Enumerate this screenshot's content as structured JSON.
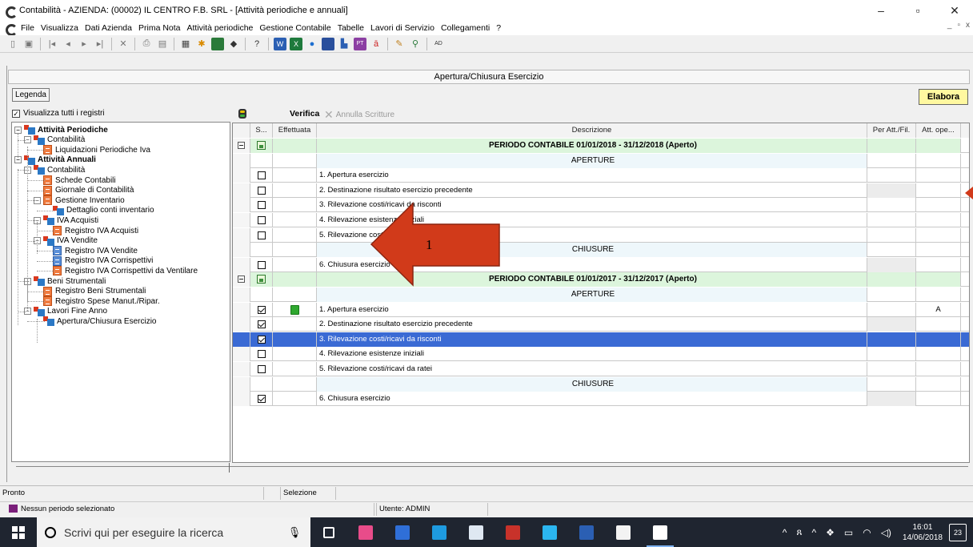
{
  "window": {
    "title": "Contabilità - AZIENDA: (00002) IL CENTRO F.B. SRL  - [Attività periodiche e annuali]",
    "minimize": "–",
    "maximize": "▫",
    "close": "✕"
  },
  "menu": {
    "items": [
      "File",
      "Visualizza",
      "Dati Azienda",
      "Prima Nota",
      "Attività periodiche",
      "Gestione Contabile",
      "Tabelle",
      "Lavori di Servizio",
      "Collegamenti",
      "?"
    ],
    "mdi": [
      "_",
      "▫",
      "x"
    ]
  },
  "toolbar": {
    "label_ad": "AD"
  },
  "form": {
    "title": "Apertura/Chiusura Esercizio",
    "legenda": "Legenda",
    "show_all_registers": "Visualizza tutti i registri",
    "show_all_checked": "✓",
    "verifica": "Verifica",
    "annulla": "Annulla Scritture",
    "elabora": "Elabora"
  },
  "tree": {
    "nodes": [
      {
        "label": "Attività Periodiche",
        "bold": true,
        "level": 0,
        "icon": "folder",
        "expander": "−"
      },
      {
        "label": "Contabilità",
        "level": 1,
        "icon": "folder",
        "expander": "−"
      },
      {
        "label": "Liquidazioni Periodiche Iva",
        "level": 2,
        "icon": "doc-orange"
      },
      {
        "label": "Attività Annuali",
        "bold": true,
        "level": 0,
        "icon": "folder",
        "expander": "−"
      },
      {
        "label": "Contabilità",
        "level": 1,
        "icon": "folder",
        "expander": "−"
      },
      {
        "label": "Schede Contabili",
        "level": 2,
        "icon": "doc-orange"
      },
      {
        "label": "Giornale di Contabilità",
        "level": 2,
        "icon": "doc-orange"
      },
      {
        "label": "Gestione Inventario",
        "level": 2,
        "icon": "doc-orange",
        "expander": "−"
      },
      {
        "label": "Dettaglio conti inventario",
        "level": 3,
        "icon": "folder"
      },
      {
        "label": "IVA Acquisti",
        "level": 2,
        "icon": "folder",
        "expander": "−"
      },
      {
        "label": "Registro IVA Acquisti",
        "level": 3,
        "icon": "doc-orange"
      },
      {
        "label": "IVA Vendite",
        "level": 2,
        "icon": "folder",
        "expander": "−"
      },
      {
        "label": "Registro IVA Vendite",
        "level": 3,
        "icon": "doc-blue"
      },
      {
        "label": "Registro IVA Corrispettivi",
        "level": 3,
        "icon": "doc-blue"
      },
      {
        "label": "Registro IVA Corrispettivi da Ventilare",
        "level": 3,
        "icon": "doc-orange"
      },
      {
        "label": "Beni Strumentali",
        "level": 1,
        "icon": "folder",
        "expander": "−"
      },
      {
        "label": "Registro Beni Strumentali",
        "level": 2,
        "icon": "doc-orange"
      },
      {
        "label": "Registro Spese Manut./Ripar.",
        "level": 2,
        "icon": "doc-orange"
      },
      {
        "label": "Lavori Fine Anno",
        "level": 1,
        "icon": "folder",
        "expander": "−"
      },
      {
        "label": "Apertura/Chiusura Esercizio",
        "level": 2,
        "icon": "folder"
      }
    ]
  },
  "grid": {
    "headers": {
      "s": "S...",
      "eff": "Effettuata",
      "desc": "Descrizione",
      "per": "Per Att./Fil.",
      "att": "Att. ope..."
    },
    "rows": [
      {
        "type": "period",
        "desc": "PERIODO CONTABILE 01/01/2018 - 31/12/2018 (Aperto)"
      },
      {
        "type": "section",
        "desc": "APERTURE"
      },
      {
        "type": "item",
        "checked": false,
        "desc": "1. Apertura esercizio",
        "att": ""
      },
      {
        "type": "item",
        "checked": false,
        "desc": "2. Destinazione risultato esercizio precedente",
        "gray": true,
        "att": ""
      },
      {
        "type": "item",
        "checked": false,
        "desc": "3. Rilevazione costi/ricavi da risconti",
        "att": ""
      },
      {
        "type": "item",
        "checked": false,
        "desc": "4. Rilevazione esistenze iniziali",
        "att": ""
      },
      {
        "type": "item",
        "checked": false,
        "desc": "5. Rilevazione costi/ricavi da ratei",
        "att": ""
      },
      {
        "type": "section",
        "desc": "CHIUSURE"
      },
      {
        "type": "item",
        "checked": false,
        "desc": "6. Chiusura esercizio",
        "gray": true,
        "att": ""
      },
      {
        "type": "period",
        "desc": "PERIODO CONTABILE 01/01/2017 - 31/12/2017 (Aperto)"
      },
      {
        "type": "section",
        "desc": "APERTURE"
      },
      {
        "type": "item",
        "checked": true,
        "done": true,
        "desc": "1. Apertura esercizio",
        "att": "A"
      },
      {
        "type": "item",
        "checked": true,
        "desc": "2. Destinazione risultato esercizio precedente",
        "gray": true,
        "att": ""
      },
      {
        "type": "item",
        "checked": true,
        "selected": true,
        "desc": "3. Rilevazione costi/ricavi da risconti",
        "att": ""
      },
      {
        "type": "item",
        "checked": false,
        "desc": "4. Rilevazione esistenze iniziali",
        "att": ""
      },
      {
        "type": "item",
        "checked": false,
        "desc": "5. Rilevazione costi/ricavi da ratei",
        "att": ""
      },
      {
        "type": "section",
        "desc": "CHIUSURE"
      },
      {
        "type": "item",
        "checked": true,
        "desc": "6. Chiusura esercizio",
        "gray": true,
        "att": ""
      }
    ]
  },
  "annotation": {
    "number": "1",
    "color": "#d13a1a"
  },
  "status": {
    "ready": "Pronto",
    "selection": "Selezione",
    "no_period": "Nessun periodo selezionato",
    "user": "Utente: ADMIN"
  },
  "taskbar": {
    "search_placeholder": "Scrivi qui per eseguire la ricerca",
    "time": "16:01",
    "date": "14/06/2018",
    "notifications": "23",
    "apps": [
      {
        "name": "task-view",
        "color": "#1f2530"
      },
      {
        "name": "paint",
        "color": "#e84c8a"
      },
      {
        "name": "app-blue",
        "color": "#2f6fd8"
      },
      {
        "name": "skype",
        "color": "#1e9be0"
      },
      {
        "name": "app-window",
        "color": "#dfe8f2"
      },
      {
        "name": "app-red",
        "color": "#c8322a"
      },
      {
        "name": "wifi",
        "color": "#2bb6f0"
      },
      {
        "name": "word",
        "color": "#2b5fb3"
      },
      {
        "name": "app-e",
        "color": "#f3f3f3"
      },
      {
        "name": "contabilita",
        "color": "#ffffff"
      }
    ]
  }
}
